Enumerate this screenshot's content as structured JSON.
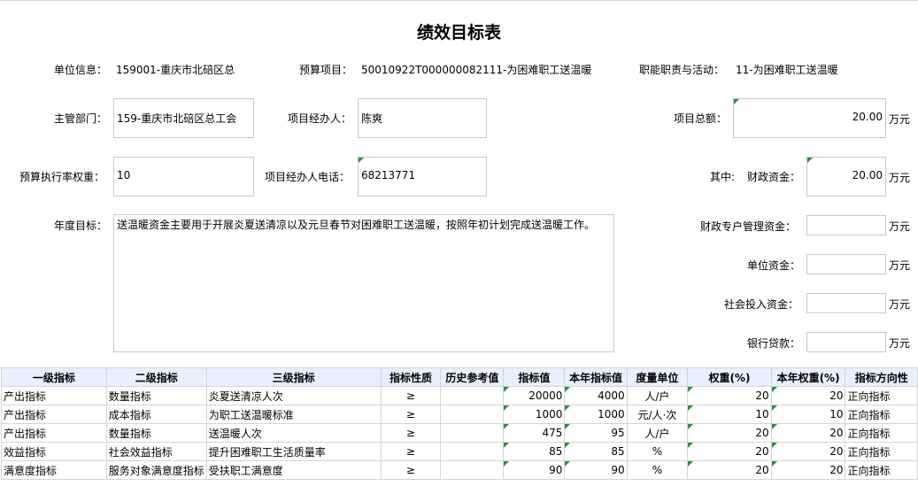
{
  "title": "绩效目标表",
  "info": {
    "unit_label": "单位信息：",
    "unit_value": "159001-重庆市北碚区总",
    "project_label": "预算项目：",
    "project_value": "50010922T000000082111-为困难职工送温暖",
    "duty_label": "职能职责与活动：",
    "duty_value": "11-为困难职工送温暖"
  },
  "form": {
    "dept_label": "主管部门：",
    "dept_value": "159-重庆市北碚区总工会",
    "manager_label": "项目经办人：",
    "manager_value": "陈爽",
    "total_label": "项目总额：",
    "total_value": "20.00",
    "weight_label": "预算执行率权重：",
    "weight_value": "10",
    "phone_label": "项目经办人电话：",
    "phone_value": "68213771",
    "among_label": "其中:",
    "fiscal_label": "财政资金：",
    "fiscal_value": "20.00",
    "goal_label": "年度目标：",
    "goal_value": "送温暖资金主要用于开展炎夏送清凉以及元旦春节对困难职工送温暖，按照年初计划完成送温暖工作。",
    "special_label": "财政专户管理资金：",
    "special_value": "",
    "unitfund_label": "单位资金：",
    "unitfund_value": "",
    "social_label": "社会投入资金：",
    "social_value": "",
    "bank_label": "银行贷款：",
    "bank_value": "",
    "unit_wan": "万元"
  },
  "table": {
    "headers": [
      "一级指标",
      "二级指标",
      "三级指标",
      "指标性质",
      "历史参考值",
      "指标值",
      "本年指标值",
      "度量单位",
      "权重(%)",
      "本年权重(%)",
      "指标方向性"
    ],
    "rows": [
      [
        "产出指标",
        "数量指标",
        "炎夏送清凉人次",
        "≥",
        "",
        "20000",
        "4000",
        "人/户",
        "20",
        "20",
        "正向指标"
      ],
      [
        "产出指标",
        "成本指标",
        "为职工送温暖标准",
        "≥",
        "",
        "1000",
        "1000",
        "元/人·次",
        "10",
        "10",
        "正向指标"
      ],
      [
        "产出指标",
        "数量指标",
        "送温暖人次",
        "≥",
        "",
        "475",
        "95",
        "人/户",
        "20",
        "20",
        "正向指标"
      ],
      [
        "效益指标",
        "社会效益指标",
        "提升困难职工生活质量率",
        "≥",
        "",
        "85",
        "85",
        "%",
        "20",
        "20",
        "正向指标"
      ],
      [
        "满意度指标",
        "服务对象满意度指标",
        "受扶职工满意度",
        "≥",
        "",
        "90",
        "90",
        "%",
        "20",
        "20",
        "正向指标"
      ]
    ]
  }
}
